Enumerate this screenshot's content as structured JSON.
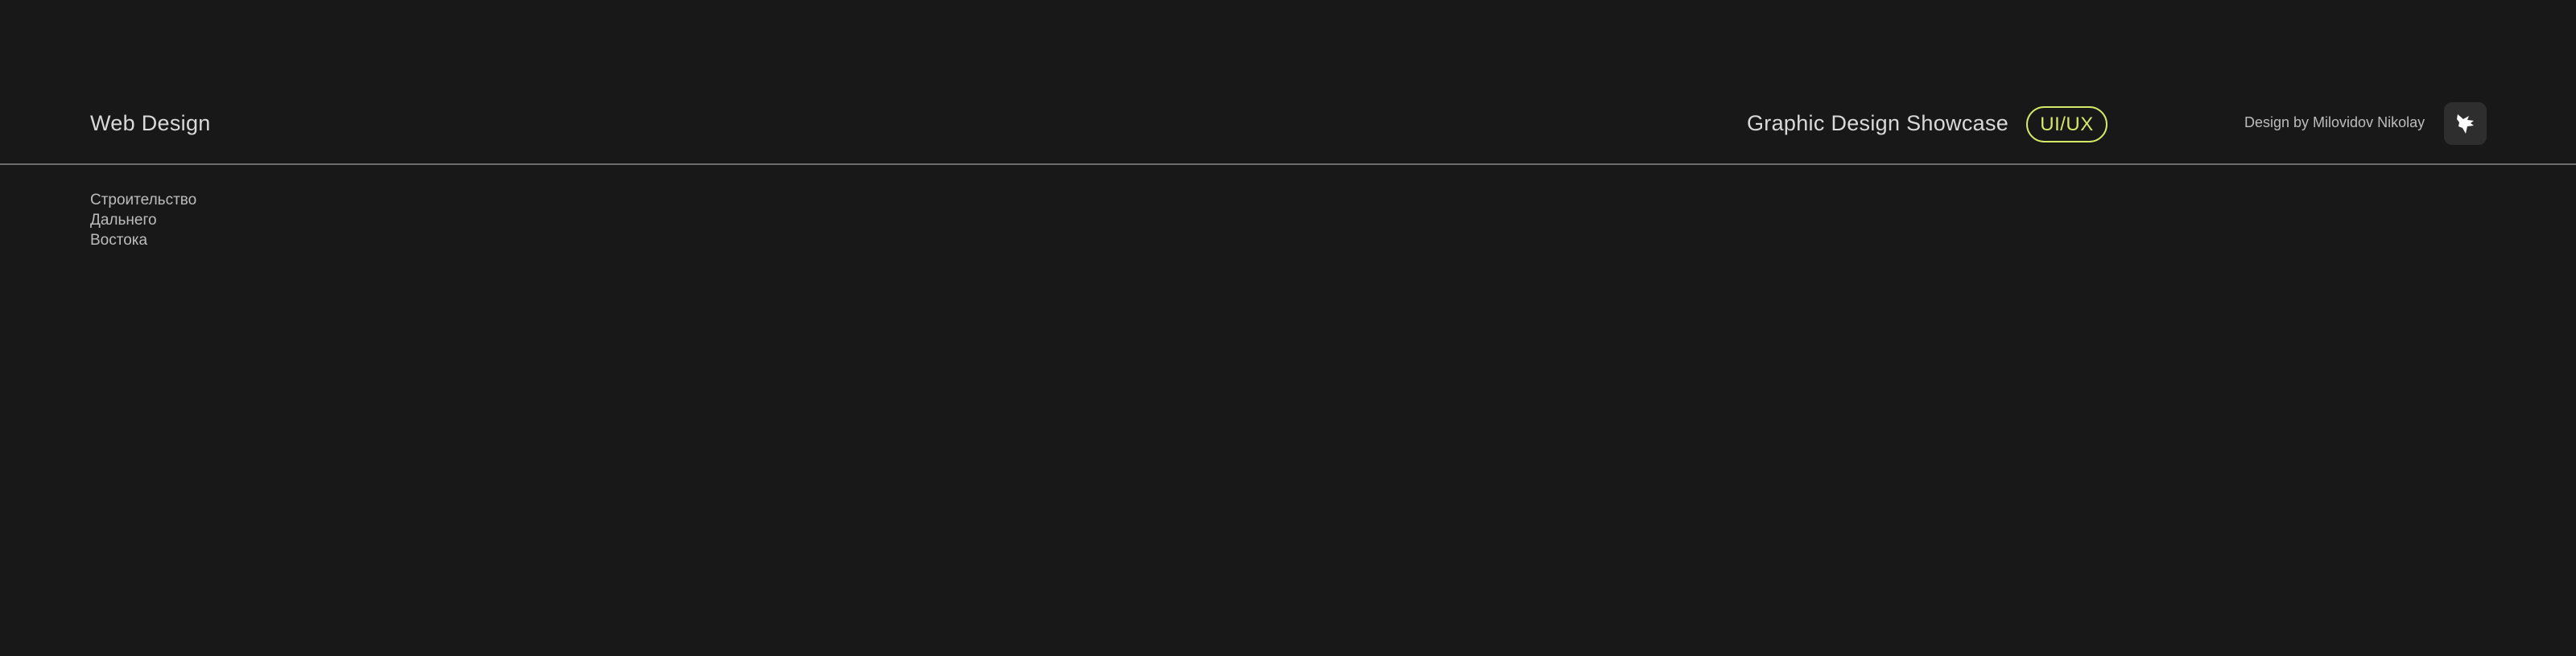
{
  "header": {
    "section_title": "Web Design",
    "showcase_title": "Graphic Design Showcase",
    "tag": "UI/UX",
    "credit": "Design by Milovidov Nikolay",
    "logo_icon": "wolf-head-logo-icon"
  },
  "project": {
    "lines": [
      "Строительство",
      "Дальнего",
      "Востока"
    ]
  },
  "colors": {
    "background": "#181818",
    "accent": "#d6e86a",
    "divider": "#6e6e6e",
    "logo_bg": "#2e2e2e"
  }
}
